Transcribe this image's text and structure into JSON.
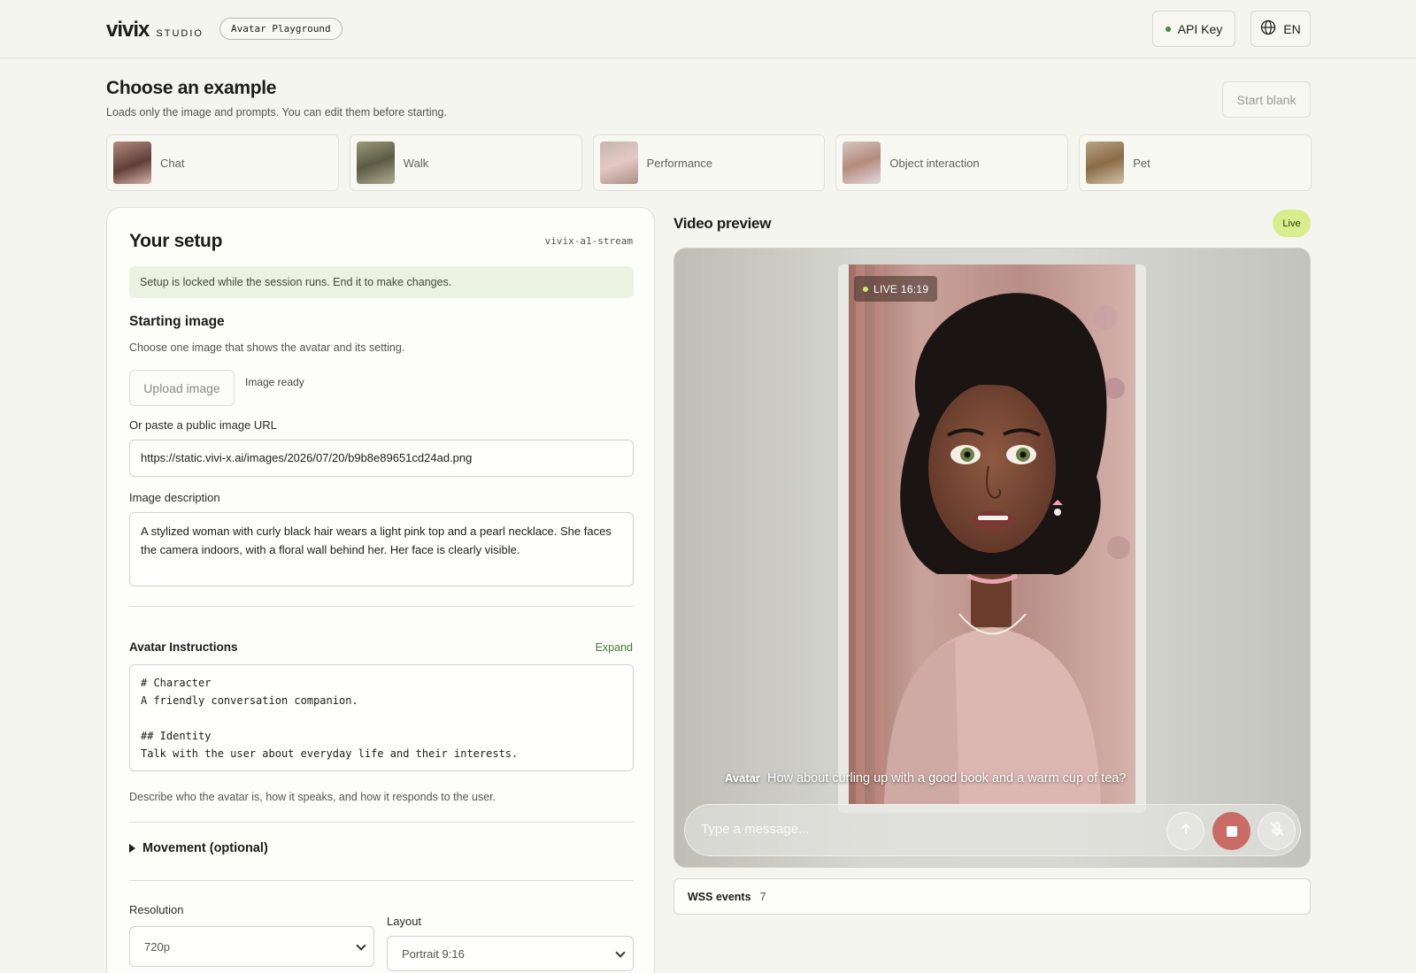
{
  "header": {
    "logo": "vivix",
    "logo_sub": "STUDIO",
    "badge": "Avatar Playground",
    "api_key_label": "API Key",
    "lang_label": "EN"
  },
  "examples": {
    "title": "Choose an example",
    "subtitle": "Loads only the image and prompts. You can edit them before starting.",
    "start_blank": "Start blank",
    "items": [
      {
        "label": "Chat"
      },
      {
        "label": "Walk"
      },
      {
        "label": "Performance"
      },
      {
        "label": "Object interaction"
      },
      {
        "label": "Pet"
      }
    ]
  },
  "setup": {
    "title": "Your setup",
    "model": "vivix-a1-stream",
    "lock_note": "Setup is locked while the session runs. End it to make changes.",
    "starting_image_title": "Starting image",
    "starting_image_sub": "Choose one image that shows the avatar and its setting.",
    "upload_label": "Upload image",
    "image_status": "Image ready",
    "url_label": "Or paste a public image URL",
    "url_value": "https://static.vivi-x.ai/images/2026/07/20/b9b8e89651cd24ad.png",
    "desc_label": "Image description",
    "desc_value": "A stylized woman with curly black hair wears a light pink top and a pearl necklace. She faces the camera indoors, with a floral wall behind her. Her face is clearly visible.",
    "instructions_label": "Avatar Instructions",
    "expand_label": "Expand",
    "instructions_value": "# Character\nA friendly conversation companion.\n\n## Identity\nTalk with the user about everyday life and their interests.",
    "instructions_hint": "Describe who the avatar is, how it speaks, and how it responds to the user.",
    "movement_label": "Movement (optional)",
    "resolution_label": "Resolution",
    "resolution_value": "720p",
    "layout_label": "Layout",
    "layout_value": "Portrait 9:16"
  },
  "preview": {
    "title": "Video preview",
    "status": "Live",
    "live_tag": "LIVE 16:19",
    "caption_speaker": "Avatar",
    "caption_text": "How about curling up with a good book and a warm cup of tea?",
    "message_placeholder": "Type a message...",
    "wss_label": "WSS events",
    "wss_count": "7"
  },
  "icons": {
    "api_status": "status-dot-icon",
    "language": "globe-icon",
    "send": "arrow-up-icon",
    "stop": "stop-icon",
    "mic": "mic-off-icon",
    "movement": "disclosure-triangle-icon"
  }
}
